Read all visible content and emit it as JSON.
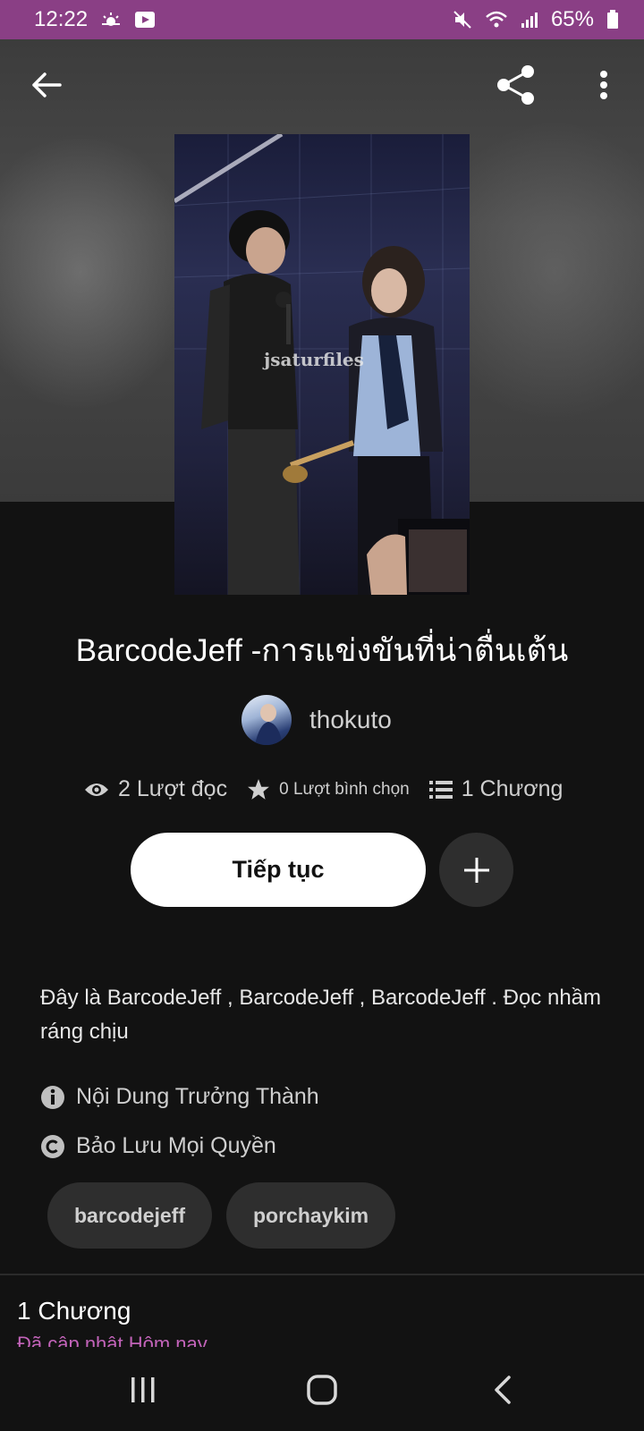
{
  "status_bar": {
    "time": "12:22",
    "battery": "65%",
    "icons_left": [
      "weather-icon",
      "video-notification-icon"
    ],
    "icons_right": [
      "mute-icon",
      "wifi-icon",
      "signal-icon",
      "battery-icon"
    ]
  },
  "colors": {
    "status_bar_bg": "#8a3f85",
    "page_bg": "#121212",
    "accent_pink": "#c263b9",
    "continue_button_bg": "#ffffff"
  },
  "cover": {
    "watermark": "jsaturfiles"
  },
  "story": {
    "title": "BarcodeJeff -การแข่งขันที่น่าตื่นเต้น",
    "author": "thokuto",
    "reads": "2 Lượt đọc",
    "votes": "0 Lượt bình chọn",
    "parts": "1 Chương",
    "description": "Đây là BarcodeJeff , BarcodeJeff , BarcodeJeff . Đọc nhầm ráng chịu",
    "mature_label": "Nội Dung Trưởng Thành",
    "copyright_label": "Bảo Lưu Mọi Quyền",
    "tags": [
      "barcodejeff",
      "porchaykim"
    ]
  },
  "actions": {
    "continue_label": "Tiếp tục"
  },
  "chapters": {
    "count_label": "1 Chương",
    "updated_label": "Đã cập nhật Hôm nay"
  }
}
